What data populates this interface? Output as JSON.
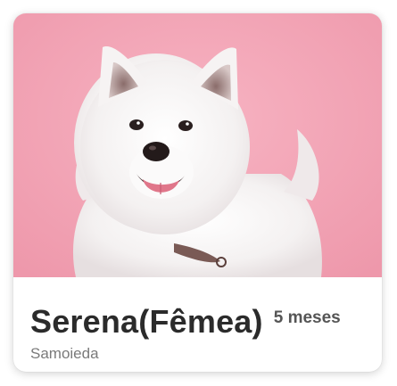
{
  "card": {
    "photo": {
      "subject": "samoyed-dog",
      "background_color": "#f2a0b2"
    },
    "name": "Serena(Fêmea)",
    "age": "5 meses",
    "breed": "Samoieda"
  },
  "colors": {
    "name_text": "#2b2b2b",
    "age_text": "#555555",
    "breed_text": "#7a7a7a"
  }
}
